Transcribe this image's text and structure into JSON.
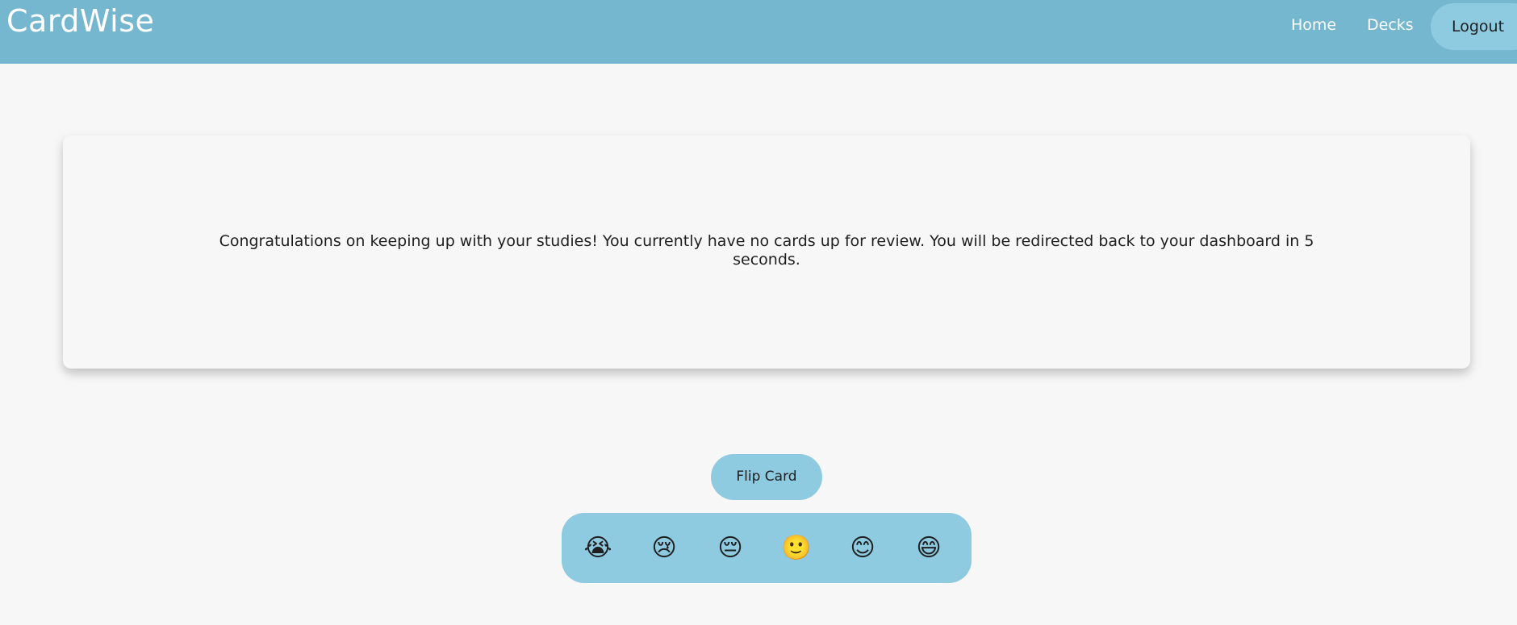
{
  "navbar": {
    "brand": "CardWise",
    "links": [
      {
        "label": "Home"
      },
      {
        "label": "Decks"
      }
    ],
    "logout_label": "Logout",
    "background": "#76b7d0"
  },
  "review": {
    "message": "Congratulations on keeping up with your studies! You currently have no cards up for review. You will be redirected back to your dashboard in 5 seconds.",
    "flip_label": "Flip Card"
  },
  "ratings": [
    {
      "icon": "loudly-crying-face-icon",
      "glyph": "😭"
    },
    {
      "icon": "crying-face-icon",
      "glyph": "😢"
    },
    {
      "icon": "pensive-face-icon",
      "glyph": "😔"
    },
    {
      "icon": "slightly-smiling-face-icon",
      "glyph": "🙂"
    },
    {
      "icon": "smiling-face-icon",
      "glyph": "😊"
    },
    {
      "icon": "grinning-face-icon",
      "glyph": "😄"
    }
  ],
  "colors": {
    "page_background": "#f7f7f7",
    "accent_button": "#8ecae0"
  }
}
